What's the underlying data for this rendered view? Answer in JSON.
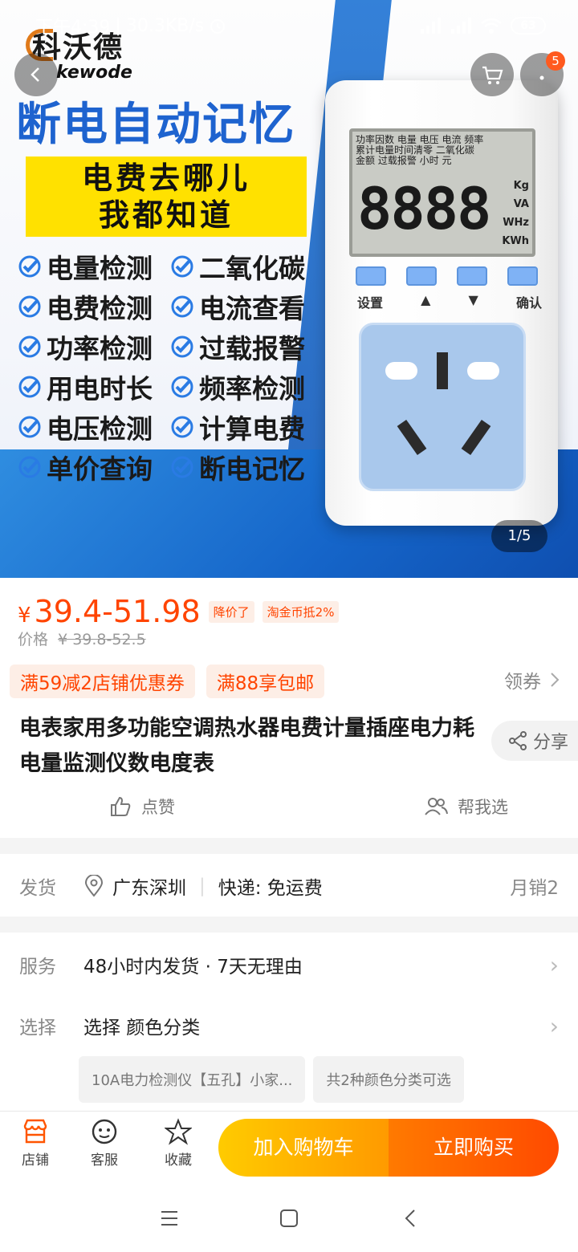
{
  "status_bar": {
    "time": "下午4:39",
    "speed": "30.3KB/s",
    "battery": "63"
  },
  "hero": {
    "brand_cn": "科沃德",
    "brand_en": "kewode",
    "headline": "断电自动记忆",
    "banner_line1": "电费去哪儿",
    "banner_line2": "我都知道",
    "features": [
      "电量检测",
      "二氧化碳",
      "电费检测",
      "电流查看",
      "功率检测",
      "过载报警",
      "用电时长",
      "频率检测",
      "电压检测",
      "计算电费",
      "单价查询",
      "断电记忆"
    ],
    "lcd_line1": "功率因数 电量 电压 电流 频率",
    "lcd_line2": "累计电量时间清零 二氧化碳",
    "lcd_line3": "金额 过载报警 小时 元",
    "lcd_digits": "8888",
    "lcd_units": [
      "Kg",
      "VA",
      "WHz",
      "KWh"
    ],
    "device_labels": [
      "设置",
      "▲",
      "▼",
      "确认"
    ],
    "cart_badge": "5",
    "pager": "1/5"
  },
  "price": {
    "currency": "¥",
    "range": "39.4-51.98",
    "tag1": "降价了",
    "tag2": "淘金币抵2%",
    "orig_label": "价格",
    "orig_value": "¥ 39.8-52.5"
  },
  "coupons": [
    "满59减2店铺优惠券",
    "满88享包邮"
  ],
  "get_coupon": "领券",
  "title": "电表家用多功能空调热水器电费计量插座电力耗电量监测仪数电度表",
  "share": "分享",
  "actions": {
    "like": "点赞",
    "help": "帮我选"
  },
  "shipping": {
    "label": "发货",
    "location": "广东深圳",
    "express": "快递: 免运费",
    "sales": "月销2"
  },
  "service": {
    "label": "服务",
    "value": "48小时内发货 · 7天无理由"
  },
  "choose": {
    "label": "选择",
    "value": "选择 颜色分类",
    "chip1": "10A电力检测仪【五孔】小家...",
    "chip2": "共2种颜色分类可选"
  },
  "bottom": {
    "shop": "店铺",
    "service": "客服",
    "favorite": "收藏",
    "add_cart": "加入购物车",
    "buy_now": "立即购买"
  },
  "colors": {
    "accent": "#ff4400",
    "cart": "#ffb300",
    "buy": "#ff5500"
  }
}
